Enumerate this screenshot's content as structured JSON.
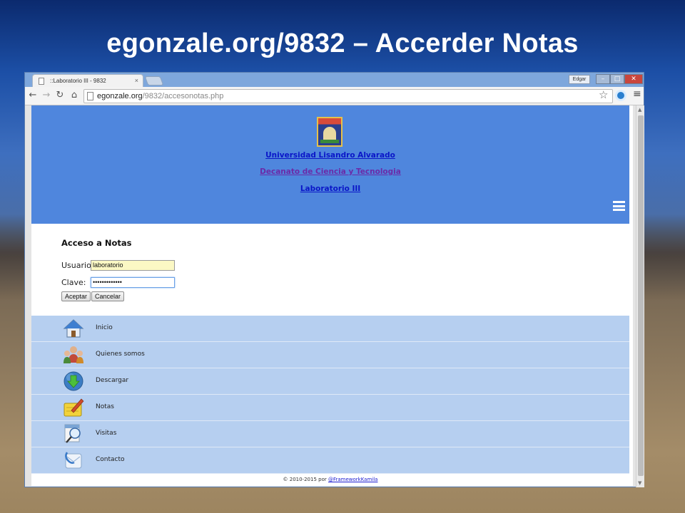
{
  "slide": {
    "title": "egonzale.org/9832 – Accerder Notas"
  },
  "browser": {
    "tab_title": "::Laboratorio III - 9832",
    "user_name": "Edgar",
    "url_host": "egonzale.org",
    "url_path": "/9832/accesonotas.php"
  },
  "page": {
    "banner": {
      "link1": "Universidad Lisandro Alvarado",
      "link2": "Decanato de Ciencia y Tecnologia",
      "link3": "Laboratorio III"
    },
    "form": {
      "title": "Acceso a Notas",
      "user_label": "Usuario:",
      "user_value": "laboratorio",
      "pass_label": "Clave:",
      "pass_value": "•••••••••••••",
      "accept": "Aceptar",
      "cancel": "Cancelar"
    },
    "menu": [
      {
        "label": "Inicio",
        "icon": "home-icon"
      },
      {
        "label": "Quienes somos",
        "icon": "people-icon"
      },
      {
        "label": "Descargar",
        "icon": "download-icon"
      },
      {
        "label": "Notas",
        "icon": "notes-icon"
      },
      {
        "label": "Visitas",
        "icon": "visits-icon"
      },
      {
        "label": "Contacto",
        "icon": "contact-icon"
      }
    ],
    "footer": {
      "text": "© 2010-2015 por ",
      "link": "@FrameworkKamila"
    }
  },
  "colors": {
    "banner": "#4f86dd",
    "menu": "#b6cff0",
    "link": "#0a16c8",
    "visited_link": "#6b2aa8"
  }
}
